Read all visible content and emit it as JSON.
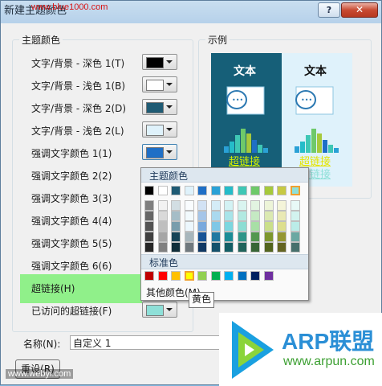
{
  "window": {
    "title": "新建主题颜色"
  },
  "watermarks": {
    "top": "www.blue1000.com",
    "bottom": "www.webyi.com"
  },
  "titlebar": {
    "help_label": "?",
    "close_label": "✕"
  },
  "theme_colors": {
    "group_label": "主题颜色",
    "rows": [
      {
        "label": "文字/背景 - 深色 1(T)",
        "color": "#000000"
      },
      {
        "label": "文字/背景 - 浅色 1(B)",
        "color": "#ffffff"
      },
      {
        "label": "文字/背景 - 深色 2(D)",
        "color": "#1f5b74"
      },
      {
        "label": "文字/背景 - 浅色 2(L)",
        "color": "#dff2fb"
      },
      {
        "label": "强调文字颜色 1(1)",
        "color": "#1f6fc6"
      },
      {
        "label": "强调文字颜色 2(2)",
        "color": ""
      },
      {
        "label": "强调文字颜色 3(3)",
        "color": ""
      },
      {
        "label": "强调文字颜色 4(4)",
        "color": ""
      },
      {
        "label": "强调文字颜色 5(5)",
        "color": ""
      },
      {
        "label": "强调文字颜色 6(6)",
        "color": ""
      },
      {
        "label": "超链接(H)",
        "color": ""
      },
      {
        "label": "已访问的超链接(F)",
        "color": "#8ee0d8"
      }
    ]
  },
  "sample": {
    "group_label": "示例",
    "text_dark": "文本",
    "text_light": "文本",
    "link_dark": "超链接",
    "link_light": "超链接",
    "visited_light": "超链接"
  },
  "color_popup": {
    "theme_header": "主题颜色",
    "standard_header": "标准色",
    "more_colors": "其他颜色(M)...",
    "tooltip": "黄色",
    "theme_top_row": [
      "#000000",
      "#ffffff",
      "#1f5b74",
      "#dff2fb",
      "#1f6fc6",
      "#2aa1d6",
      "#25bcc9",
      "#3fc7b5",
      "#6ec96a",
      "#a6c93c",
      "#c7c943",
      "#8ee0d8"
    ],
    "standard_row": [
      "#c00000",
      "#ff0000",
      "#ffc000",
      "#ffff00",
      "#92d050",
      "#00b050",
      "#00b0f0",
      "#0070c0",
      "#002060",
      "#7030a0"
    ]
  },
  "name_field": {
    "label": "名称(N):",
    "value": "自定义 1"
  },
  "buttons": {
    "reset": "重设(R)"
  },
  "logo": {
    "brand": "ARP联盟",
    "url": "www.arpun.com"
  }
}
